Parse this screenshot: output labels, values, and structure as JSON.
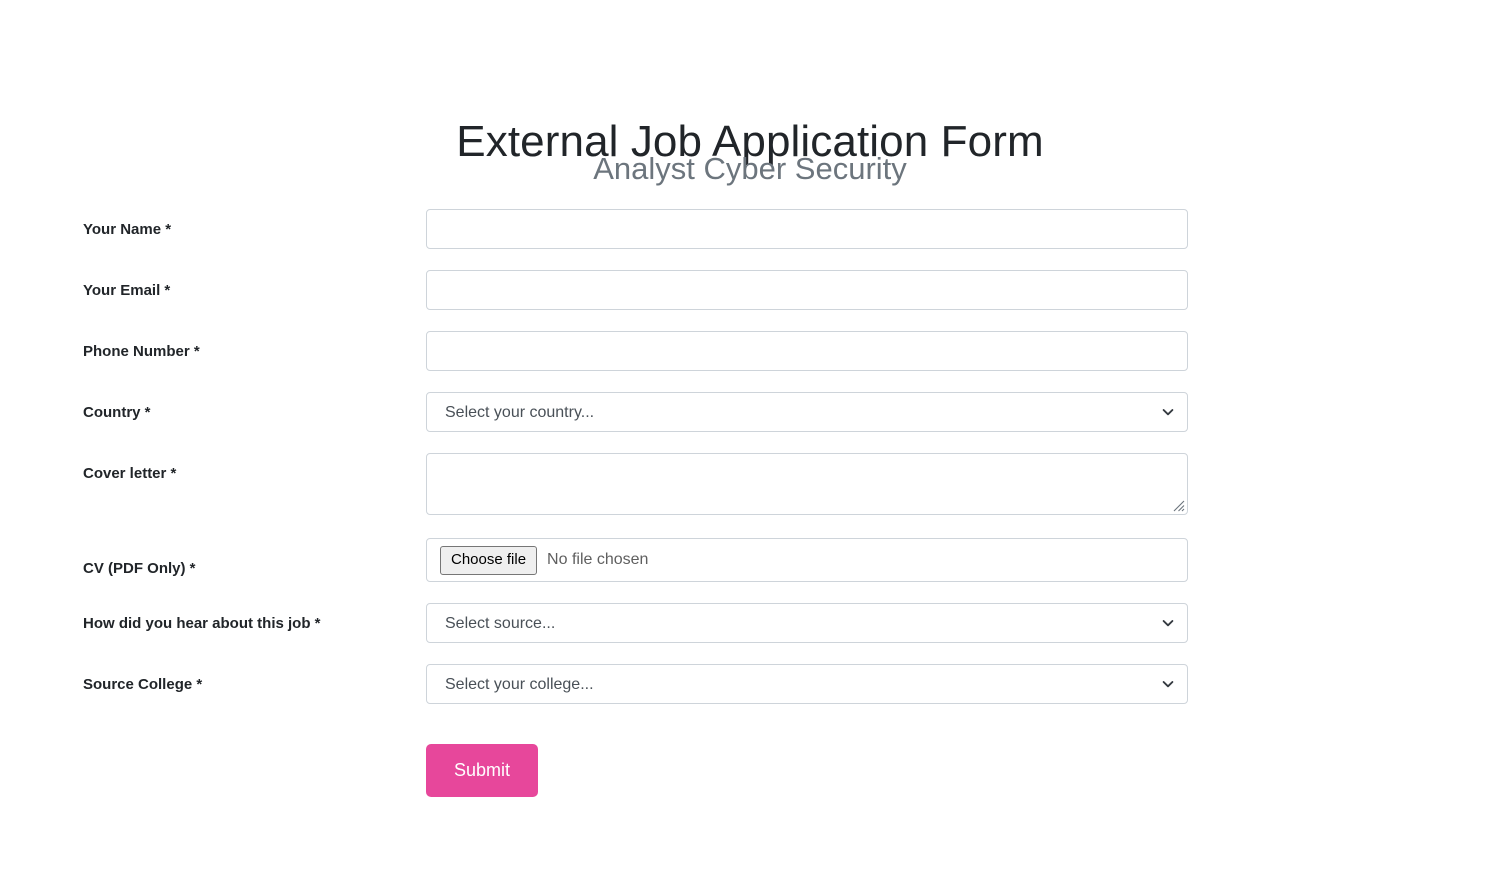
{
  "header": {
    "title": "External Job Application Form",
    "subtitle": "Analyst Cyber Security"
  },
  "form": {
    "fields": [
      {
        "label": "Your Name *",
        "type": "text",
        "value": "",
        "placeholder": ""
      },
      {
        "label": "Your Email *",
        "type": "text",
        "value": "",
        "placeholder": ""
      },
      {
        "label": "Phone Number *",
        "type": "text",
        "value": "",
        "placeholder": ""
      },
      {
        "label": "Country *",
        "type": "select",
        "selected": "Select your country...",
        "icon": "chevron-down-icon"
      },
      {
        "label": "Cover letter *",
        "type": "textarea",
        "value": "",
        "placeholder": ""
      },
      {
        "label": "CV (PDF Only) *",
        "type": "file",
        "button_label": "Choose file",
        "status": "No file chosen"
      },
      {
        "label": "How did you hear about this job *",
        "type": "select",
        "selected": "Select source...",
        "icon": "chevron-down-icon"
      },
      {
        "label": "Source College *",
        "type": "select",
        "selected": "Select your college...",
        "icon": "chevron-down-icon"
      }
    ],
    "submit_label": "Submit"
  },
  "colors": {
    "accent_pink": "#e7479b",
    "border": "#ced4da",
    "label_text": "#212529",
    "muted_text": "#6c757d",
    "background": "#ffffff"
  }
}
